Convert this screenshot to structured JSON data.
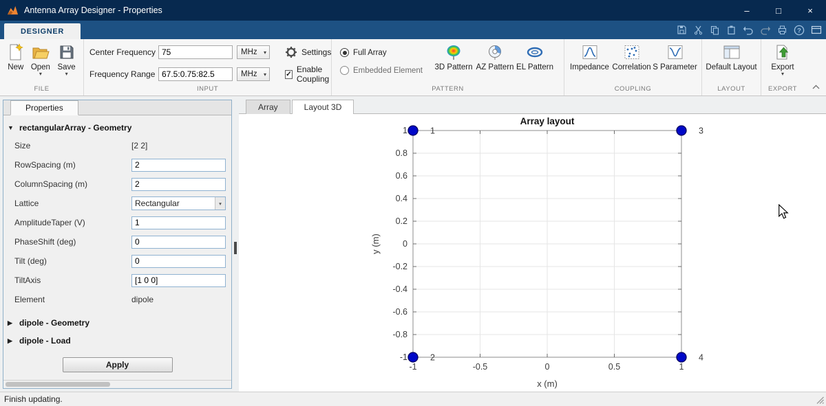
{
  "window": {
    "title": "Antenna Array Designer - Properties",
    "controls": {
      "minimize": "–",
      "maximize": "□",
      "close": "×"
    }
  },
  "toolstrip": {
    "tab": "DESIGNER",
    "sections": {
      "file": {
        "label": "FILE",
        "new": "New",
        "open": "Open",
        "save": "Save"
      },
      "input": {
        "label": "INPUT",
        "center_frequency": {
          "label": "Center Frequency",
          "value": "75",
          "unit": "MHz"
        },
        "frequency_range": {
          "label": "Frequency Range",
          "value": "67.5:0.75:82.5",
          "unit": "MHz"
        },
        "settings": "Settings",
        "enable_coupling": "Enable Coupling",
        "enable_coupling_checked": true
      },
      "pattern": {
        "label": "PATTERN",
        "full_array": "Full Array",
        "embedded_element": "Embedded Element",
        "selected_radio": "Full Array",
        "buttons": [
          "3D Pattern",
          "AZ Pattern",
          "EL Pattern"
        ]
      },
      "coupling": {
        "label": "COUPLING",
        "buttons": [
          "Impedance",
          "Correlation",
          "S Parameter"
        ]
      },
      "layout": {
        "label": "LAYOUT",
        "buttons": [
          "Default Layout"
        ]
      },
      "export": {
        "label": "EXPORT",
        "buttons": [
          "Export"
        ]
      }
    }
  },
  "properties_panel": {
    "tab": "Properties",
    "groups": [
      {
        "title": "rectangularArray - Geometry",
        "expanded": true
      },
      {
        "title": "dipole - Geometry",
        "expanded": false
      },
      {
        "title": "dipole - Load",
        "expanded": false
      }
    ],
    "rows": [
      {
        "label": "Size",
        "value": "[2 2]"
      },
      {
        "label": "RowSpacing (m)",
        "value": "2"
      },
      {
        "label": "ColumnSpacing (m)",
        "value": "2"
      },
      {
        "label": "Lattice",
        "value": "Rectangular"
      },
      {
        "label": "AmplitudeTaper (V)",
        "value": "1"
      },
      {
        "label": "PhaseShift (deg)",
        "value": "0"
      },
      {
        "label": "Tilt (deg)",
        "value": "0"
      },
      {
        "label": "TiltAxis",
        "value": "[1 0 0]"
      },
      {
        "label": "Element",
        "value": "dipole"
      }
    ],
    "apply": "Apply"
  },
  "document": {
    "tabs": [
      "Array",
      "Layout 3D"
    ],
    "active_tab": "Layout 3D"
  },
  "statusbar": {
    "text": "Finish updating."
  },
  "glyphs": {
    "caret_down": "▾",
    "triangle_down": "▼",
    "triangle_right": "▶",
    "check": "✓"
  },
  "chart_data": {
    "type": "scatter",
    "title": "Array layout",
    "xlabel": "x (m)",
    "ylabel": "y (m)",
    "xlim": [
      -1,
      1
    ],
    "ylim": [
      -1,
      1
    ],
    "xticks": [
      -1,
      -0.5,
      0,
      0.5,
      1
    ],
    "yticks": [
      -1,
      -0.8,
      -0.6,
      -0.4,
      -0.2,
      0,
      0.2,
      0.4,
      0.6,
      0.8,
      1
    ],
    "grid": true,
    "marker_color": "#0008C8",
    "marker_edge": "#000060",
    "points": [
      {
        "x": -1,
        "y": 1,
        "label": "1"
      },
      {
        "x": -1,
        "y": -1,
        "label": "2"
      },
      {
        "x": 1,
        "y": 1,
        "label": "3"
      },
      {
        "x": 1,
        "y": -1,
        "label": "4"
      }
    ]
  }
}
